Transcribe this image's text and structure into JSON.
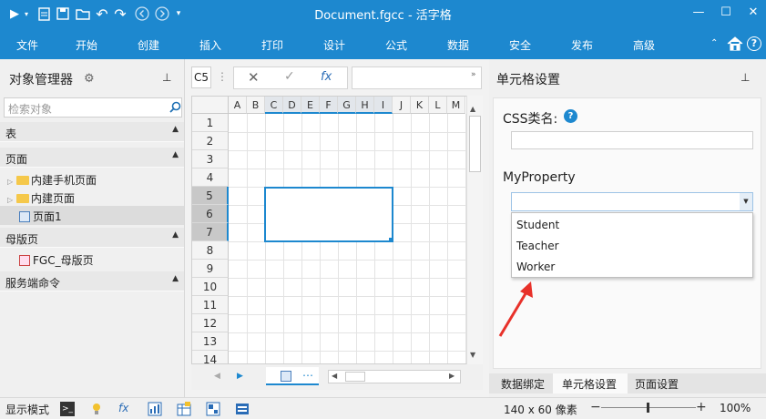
{
  "titlebar": {
    "title": "Document.fgcc - 活字格",
    "minimize": "—",
    "maximize": "☐",
    "close": "✕",
    "qa_icons": [
      "run-icon",
      "new-doc-icon",
      "save-icon",
      "open-icon",
      "undo-icon",
      "redo-icon",
      "back-icon",
      "forward-icon",
      "customize-icon"
    ]
  },
  "menu": [
    "文件",
    "开始",
    "创建",
    "插入",
    "打印",
    "设计",
    "公式",
    "数据",
    "安全",
    "发布",
    "高级"
  ],
  "left": {
    "title": "对象管理器",
    "search_placeholder": "检索对象",
    "sections": {
      "table": "表",
      "page": "页面",
      "master": "母版页",
      "server": "服务端命令"
    },
    "pages": [
      "内建手机页面",
      "内建页面",
      "页面1"
    ],
    "masters": [
      "FGC_母版页"
    ]
  },
  "formula": {
    "cellref": "C5",
    "cancel": "✕",
    "confirm": "✓",
    "fx": "fx"
  },
  "grid": {
    "columns": [
      "A",
      "B",
      "C",
      "D",
      "E",
      "F",
      "G",
      "H",
      "I",
      "J",
      "K",
      "L",
      "M"
    ],
    "rows": [
      "1",
      "2",
      "3",
      "4",
      "5",
      "6",
      "7",
      "8",
      "9",
      "10",
      "11",
      "12",
      "13",
      "14"
    ]
  },
  "right": {
    "title": "单元格设置",
    "css_label": "CSS类名:",
    "prop_label": "MyProperty",
    "options": [
      "Student",
      "Teacher",
      "Worker"
    ],
    "tabs": [
      "数据绑定",
      "单元格设置",
      "页面设置"
    ]
  },
  "status": {
    "mode": "显示模式",
    "size": "140 x 60 像素",
    "zoom": "100%",
    "zoom_level_fraction": 0.5
  },
  "colors": {
    "accent": "#1d88cf",
    "arrow": "#e8312a"
  }
}
